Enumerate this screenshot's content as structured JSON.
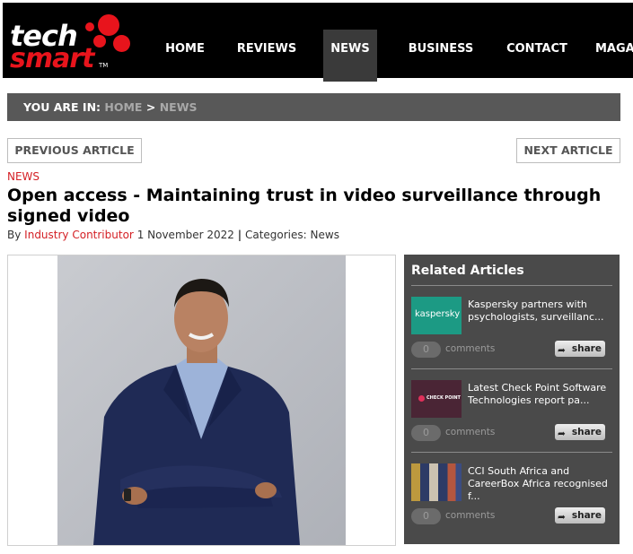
{
  "logo": {
    "line1": "tech",
    "line2": "smart",
    "tm": "TM"
  },
  "nav": [
    "HOME",
    "REVIEWS",
    "NEWS",
    "BUSINESS",
    "CONTACT",
    "MAGA"
  ],
  "breadcrumb": {
    "label": "YOU ARE IN:",
    "home": "HOME",
    "sep": ">",
    "current": "NEWS"
  },
  "article_nav": {
    "prev": "PREVIOUS ARTICLE",
    "next": "NEXT ARTICLE"
  },
  "article": {
    "category": "NEWS",
    "title": "Open access - Maintaining trust in video surveillance through signed video",
    "by": "By",
    "author": "Industry Contributor",
    "date": "1 November 2022",
    "sep": "|",
    "categories_label": "Categories:",
    "categories_value": "News"
  },
  "related": {
    "heading": "Related Articles",
    "items": [
      {
        "title": "Kaspersky partners with psychologists, surveillanc...",
        "thumb_label": "kaspersky",
        "comments_count": "0",
        "comments_label": "comments",
        "share_label": "share"
      },
      {
        "title": "Latest Check Point Software Technologies report pa...",
        "thumb_label": "CHECK POINT",
        "comments_count": "0",
        "comments_label": "comments",
        "share_label": "share"
      },
      {
        "title": "CCI South Africa and CareerBox Africa recognised f...",
        "thumb_label": "",
        "comments_count": "0",
        "comments_label": "comments",
        "share_label": "share"
      }
    ]
  },
  "colors": {
    "accent_red": "#e8141c",
    "header_bg": "#000000",
    "breadcrumb_bg": "#585858",
    "related_bg": "#4a4a4a",
    "kaspersky_green": "#1c9a84"
  }
}
